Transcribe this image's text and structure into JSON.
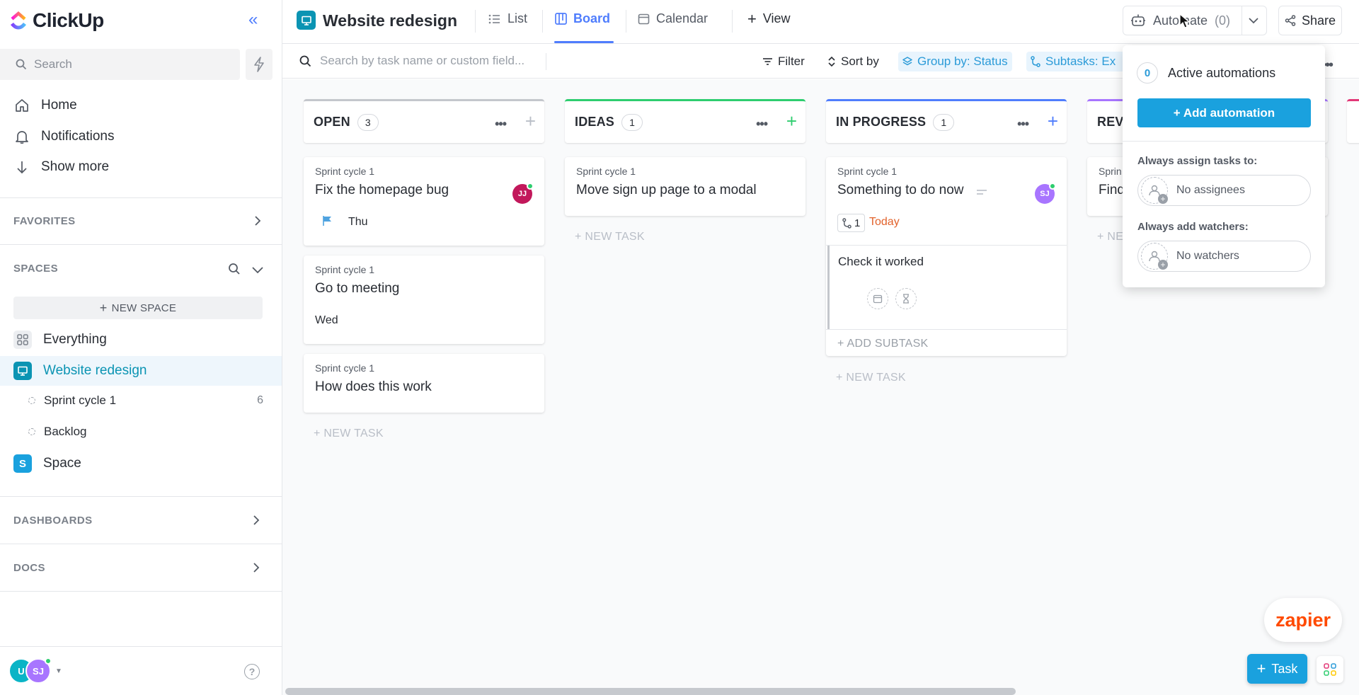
{
  "brand": {
    "name": "ClickUp"
  },
  "sidebar": {
    "search_placeholder": "Search",
    "nav": [
      {
        "label": "Home"
      },
      {
        "label": "Notifications"
      },
      {
        "label": "Show more"
      }
    ],
    "favorites_label": "FAVORITES",
    "spaces_label": "SPACES",
    "new_space_label": "NEW SPACE",
    "spaces": [
      {
        "label": "Everything"
      },
      {
        "label": "Website redesign"
      },
      {
        "label": "Space",
        "icon_letter": "S"
      }
    ],
    "lists": [
      {
        "label": "Sprint cycle 1",
        "count": "6"
      },
      {
        "label": "Backlog"
      }
    ],
    "dashboards_label": "DASHBOARDS",
    "docs_label": "DOCS",
    "user_avatars": [
      {
        "initials": "U"
      },
      {
        "initials": "SJ"
      }
    ]
  },
  "header": {
    "project_title": "Website redesign",
    "tabs": [
      {
        "label": "List"
      },
      {
        "label": "Board"
      },
      {
        "label": "Calendar"
      }
    ],
    "add_view_label": "View",
    "automate_label": "Automate",
    "automate_count": "(0)",
    "share_label": "Share"
  },
  "toolbar": {
    "search_placeholder": "Search by task name or custom field...",
    "filter_label": "Filter",
    "sort_label": "Sort by",
    "group_label": "Group by: Status",
    "subtasks_label": "Subtasks: Ex"
  },
  "board": {
    "columns": [
      {
        "name": "OPEN",
        "count": "3",
        "color": "#c4c7cc"
      },
      {
        "name": "IDEAS",
        "count": "1",
        "color": "#2ecd6f"
      },
      {
        "name": "IN PROGRESS",
        "count": "1",
        "color": "#4f7dfd"
      },
      {
        "name": "REV",
        "color": "#a875ff"
      },
      {
        "name": "",
        "color": "#e23877"
      }
    ],
    "cards": [
      {
        "list": "Sprint cycle 1",
        "title": "Fix the homepage bug",
        "date": "Thu",
        "avatar": "JJ"
      },
      {
        "list": "Sprint cycle 1",
        "title": "Go to meeting",
        "date": "Wed"
      },
      {
        "list": "Sprint cycle 1",
        "title": "How does this work"
      },
      {
        "list": "Sprint cycle 1",
        "title": "Move sign up page to a modal"
      },
      {
        "list": "Sprint cycle 1",
        "title": "Something to do now",
        "subtask_count": "1",
        "date": "Today",
        "avatar": "SJ"
      },
      {
        "list": "Sprin",
        "title": "Find"
      }
    ],
    "subtask": {
      "title": "Check it worked",
      "add_label": "+ ADD SUBTASK"
    },
    "new_task_label": "+ NEW TASK",
    "new_task_partial": "+ NE"
  },
  "automate_panel": {
    "active_count": "0",
    "active_label": "Active automations",
    "add_label": "+ Add automation",
    "assign_label": "Always assign tasks to:",
    "assign_value": "No assignees",
    "watchers_label": "Always add watchers:",
    "watchers_value": "No watchers"
  },
  "widgets": {
    "zapier_label": "zapier",
    "task_button_label": "Task"
  }
}
